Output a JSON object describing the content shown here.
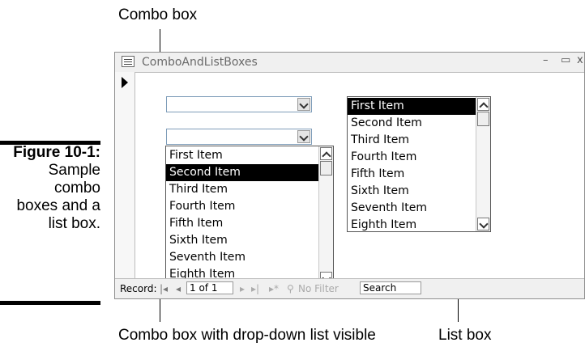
{
  "callouts": {
    "combo_box": "Combo box",
    "combo_dropdown": "Combo box with drop-down list visible",
    "list_box": "List box"
  },
  "caption": {
    "figure": "Figure 10-1:",
    "line1": "Sample",
    "line2": "combo",
    "line3": "boxes and a",
    "line4": "list box."
  },
  "window": {
    "title": "ComboAndListBoxes",
    "minimize": "–",
    "maximize": "▭",
    "close": "x"
  },
  "combo1": {
    "value": ""
  },
  "combo2": {
    "value": "",
    "items": [
      "First Item",
      "Second Item",
      "Third Item",
      "Fourth Item",
      "Fifth Item",
      "Sixth Item",
      "Seventh Item",
      "Eighth Item"
    ],
    "selected_index": 1
  },
  "listbox": {
    "items": [
      "First Item",
      "Second Item",
      "Third Item",
      "Fourth Item",
      "Fifth Item",
      "Sixth Item",
      "Seventh Item",
      "Eighth Item"
    ],
    "selected_index": 0
  },
  "record_nav": {
    "label": "Record:",
    "first": "|◂",
    "prev": "◂",
    "current": "1 of 1",
    "next": "▸",
    "last": "▸|",
    "new": "▸*",
    "filter": "No Filter",
    "search": "Search"
  }
}
